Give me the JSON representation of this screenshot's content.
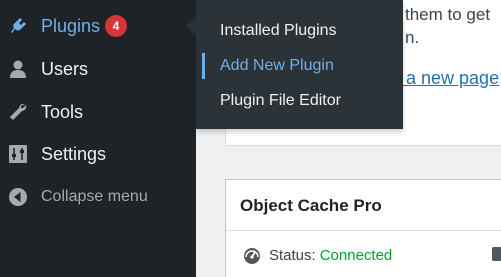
{
  "sidebar": {
    "items": [
      {
        "label": "Plugins",
        "icon": "plugin-icon",
        "badge": "4"
      },
      {
        "label": "Users",
        "icon": "users-icon"
      },
      {
        "label": "Tools",
        "icon": "wrench-icon"
      },
      {
        "label": "Settings",
        "icon": "settings-icon"
      },
      {
        "label": "Collapse menu",
        "icon": "collapse-icon"
      }
    ]
  },
  "submenu": {
    "items": [
      {
        "label": "Installed Plugins"
      },
      {
        "label": "Add New Plugin"
      },
      {
        "label": "Plugin File Editor"
      }
    ]
  },
  "content": {
    "text_fragment_1": "them to get",
    "text_fragment_2": "n.",
    "link_fragment": "l a new page"
  },
  "card": {
    "title": "Object Cache Pro",
    "status_label": "Status:",
    "status_value": "Connected",
    "status_icon": "dashboard-icon"
  },
  "colors": {
    "sidebar_bg": "#1d2327",
    "flyout_bg": "#2c3338",
    "accent_blue": "#72aee6",
    "badge_red": "#d63638",
    "connected_green": "#00a32a",
    "link_blue": "#2271b1"
  }
}
